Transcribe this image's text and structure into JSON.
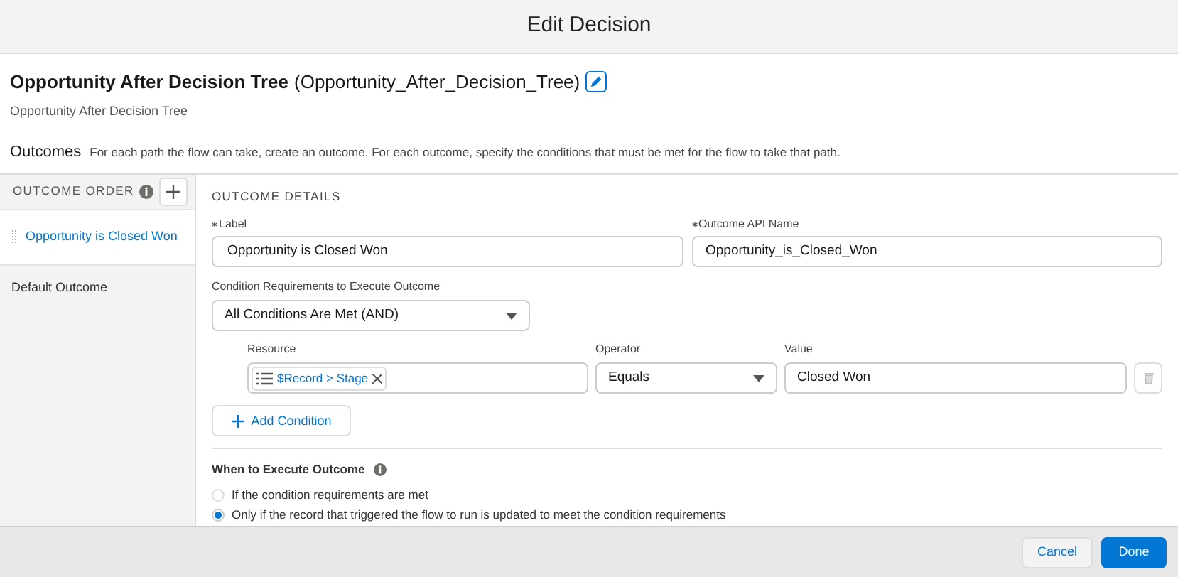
{
  "modal": {
    "title": "Edit Decision"
  },
  "element": {
    "label": "Opportunity After Decision Tree",
    "api_name": "(Opportunity_After_Decision_Tree)",
    "description": "Opportunity After Decision Tree"
  },
  "outcomes": {
    "heading": "Outcomes",
    "help": "For each path the flow can take, create an outcome. For each outcome, specify the conditions that must be met for the flow to take that path."
  },
  "outcome_order": {
    "heading": "OUTCOME ORDER",
    "items": [
      {
        "label": "Opportunity is Closed Won",
        "selected": true,
        "draggable": true
      },
      {
        "label": "Default Outcome",
        "selected": false,
        "draggable": false
      }
    ]
  },
  "details": {
    "heading": "OUTCOME DETAILS",
    "label_field": {
      "label": "Label",
      "required": true,
      "value": "Opportunity is Closed Won"
    },
    "api_field": {
      "label": "Outcome API Name",
      "required": true,
      "value": "Opportunity_is_Closed_Won"
    },
    "requirements": {
      "label": "Condition Requirements to Execute Outcome",
      "value": "All Conditions Are Met (AND)"
    },
    "condition": {
      "resource_label": "Resource",
      "resource": "$Record > Stage",
      "operator_label": "Operator",
      "operator": "Equals",
      "value_label": "Value",
      "value": "Closed Won"
    },
    "add_condition": "Add Condition",
    "when": {
      "heading": "When to Execute Outcome",
      "options": [
        {
          "label": "If the condition requirements are met",
          "selected": false
        },
        {
          "label": "Only if the record that triggered the flow to run is updated to meet the condition requirements",
          "selected": true
        }
      ]
    }
  },
  "buttons": [
    {
      "label": "Cancel",
      "kind": "neutral"
    },
    {
      "label": "Done",
      "kind": "brand"
    }
  ]
}
